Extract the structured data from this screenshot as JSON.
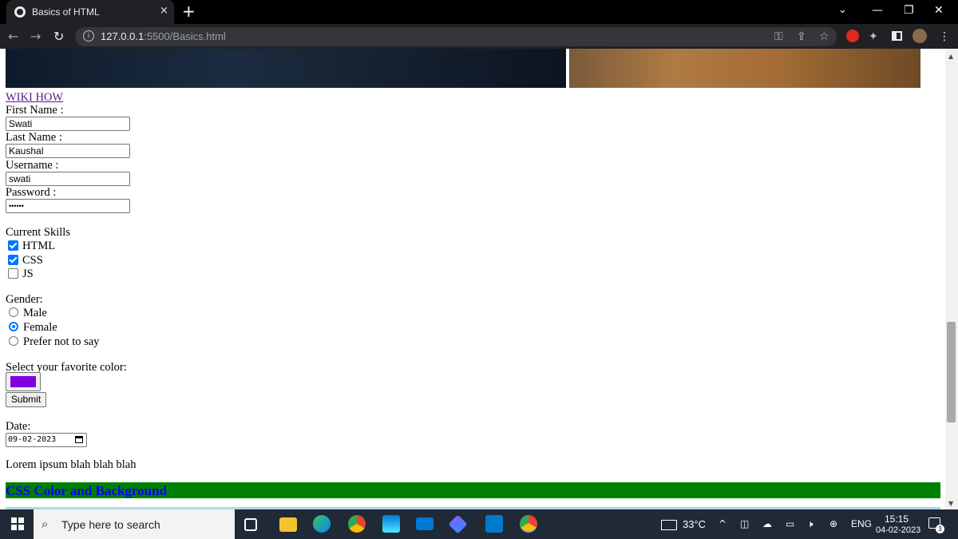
{
  "browser": {
    "tab_title": "Basics of HTML",
    "tab_close": "×",
    "new_tab": "+",
    "url_host": "127.0.0.1",
    "url_rest": ":5500/Basics.html",
    "window_min": "—",
    "window_restore": "❐",
    "window_close": "✕",
    "tab_search": "⌄"
  },
  "page": {
    "link_text": "WIKI HOW",
    "first_name_label": "First Name :",
    "first_name_value": "Swati",
    "last_name_label": "Last Name :",
    "last_name_value": "Kaushal",
    "username_label": "Username :",
    "username_value": "swati",
    "password_label": "Password :",
    "password_value": "••••••",
    "skills_heading": "Current Skills",
    "skills": [
      {
        "label": "HTML",
        "checked": true
      },
      {
        "label": "CSS",
        "checked": true
      },
      {
        "label": "JS",
        "checked": false
      }
    ],
    "gender_heading": "Gender:",
    "genders": [
      {
        "label": "Male",
        "selected": false
      },
      {
        "label": "Female",
        "selected": true
      },
      {
        "label": "Prefer not to say",
        "selected": false
      }
    ],
    "color_label": "Select your favorite color:",
    "color_value": "#8000e0",
    "submit_label": "Submit",
    "date_label": "Date:",
    "date_value": "09-02-2023",
    "lorem": "Lorem ipsum blah blah blah",
    "banner_heading": "CSS Color and Background"
  },
  "taskbar": {
    "search_placeholder": "Type here to search",
    "temperature": "33°C",
    "language": "ENG",
    "time": "15:15",
    "date": "04-02-2023",
    "notification_count": "3"
  }
}
